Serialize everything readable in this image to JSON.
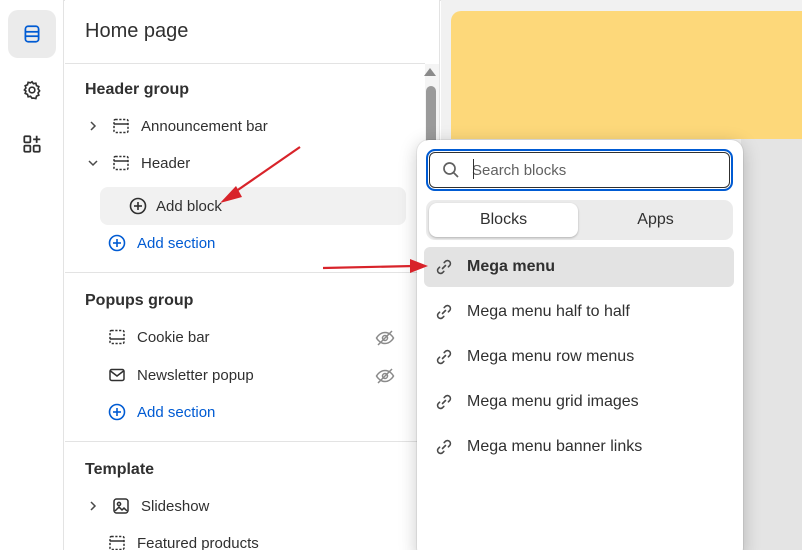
{
  "panel": {
    "title": "Home page"
  },
  "header_group": {
    "title": "Header group",
    "items": [
      {
        "label": "Announcement bar"
      },
      {
        "label": "Header"
      }
    ],
    "add_block": "Add block",
    "add_section": "Add section"
  },
  "popups_group": {
    "title": "Popups group",
    "items": [
      {
        "label": "Cookie bar"
      },
      {
        "label": "Newsletter popup"
      }
    ],
    "add_section": "Add section"
  },
  "template": {
    "title": "Template",
    "items": [
      {
        "label": "Slideshow"
      },
      {
        "label": "Featured products"
      }
    ]
  },
  "popover": {
    "search_placeholder": "Search blocks",
    "tabs": [
      {
        "label": "Blocks",
        "active": true
      },
      {
        "label": "Apps",
        "active": false
      }
    ],
    "items": [
      {
        "label": "Mega menu"
      },
      {
        "label": "Mega menu half to half"
      },
      {
        "label": "Mega menu row menus"
      },
      {
        "label": "Mega menu grid images"
      },
      {
        "label": "Mega menu banner links"
      }
    ]
  },
  "colors": {
    "accent_blue": "#005bd3",
    "annotation_red": "#d8232a",
    "preview_yellow": "#fdd87a"
  },
  "icons": [
    "sections-icon",
    "gear-icon",
    "apps-add-icon",
    "chevron-right-icon",
    "chevron-down-icon",
    "section-icon",
    "plus-circle-icon",
    "eye-off-icon",
    "mail-icon",
    "image-section-icon",
    "search-icon",
    "link-icon"
  ]
}
